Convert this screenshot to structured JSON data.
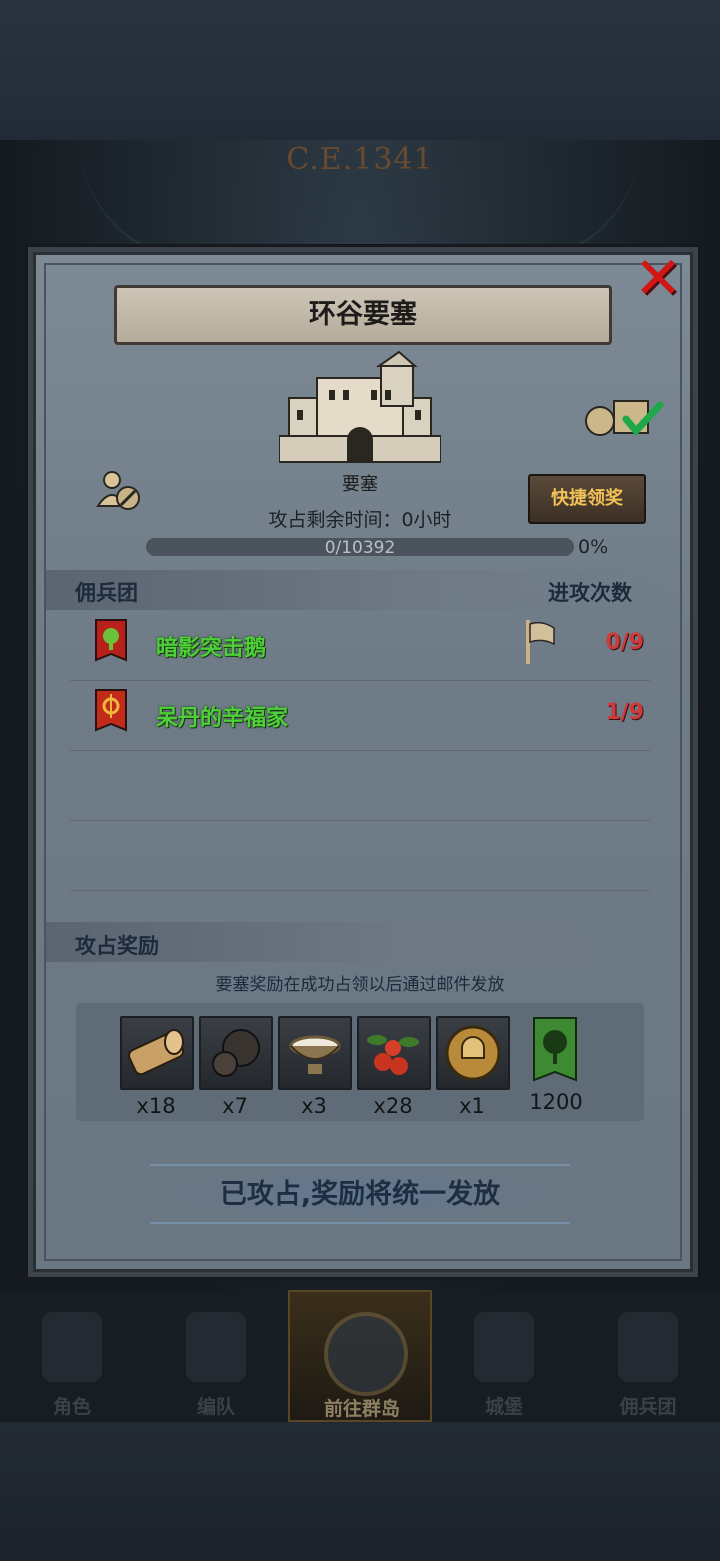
{
  "era": "C.E.1341",
  "dialog": {
    "title": "环谷要塞",
    "close_icon": "close-x-icon",
    "building_type": "要塞",
    "time_remaining_label": "攻占剩余时间：0小时",
    "quick_claim_label": "快捷领奖",
    "progress": {
      "text": "0/10392",
      "percent_label": "0%",
      "fraction": 0
    }
  },
  "mercenary_section": {
    "header": "佣兵团",
    "attack_count_header": "进攻次数",
    "rows": [
      {
        "name": "暗影突击鹅",
        "count": "0/9",
        "has_flag": true,
        "banner_color": "#b8201a",
        "emblem": "tree-emblem"
      },
      {
        "name": "呆丹的辛福家",
        "count": "1/9",
        "has_flag": false,
        "banner_color": "#c22a1a",
        "emblem": "sun-emblem"
      }
    ]
  },
  "reward_section": {
    "header": "攻占奖励",
    "note": "要塞奖励在成功占领以后通过邮件发放",
    "rewards": [
      {
        "icon": "wood-log-icon",
        "qty": "x18"
      },
      {
        "icon": "truffle-icon",
        "qty": "x7"
      },
      {
        "icon": "milk-bowl-icon",
        "qty": "x3"
      },
      {
        "icon": "berries-icon",
        "qty": "x28"
      },
      {
        "icon": "helmet-medal-icon",
        "qty": "x1"
      },
      {
        "icon": "green-banner-icon",
        "qty": "1200"
      }
    ]
  },
  "bottom_status": "已攻占,奖励将统一发放",
  "nav": {
    "items": [
      {
        "label": "角色",
        "icon": "knight-icon",
        "active": false
      },
      {
        "label": "编队",
        "icon": "helmet-icon",
        "active": false
      },
      {
        "label": "前往群岛",
        "icon": "globe-icon",
        "active": true
      },
      {
        "label": "城堡",
        "icon": "castle-icon",
        "active": false
      },
      {
        "label": "佣兵团",
        "icon": "mercenary-banner-icon",
        "active": false
      }
    ]
  },
  "colors": {
    "accent_gold": "#f2c257",
    "name_green": "#4fd038",
    "count_red": "#cc3b3b",
    "close_red": "#d21616"
  }
}
